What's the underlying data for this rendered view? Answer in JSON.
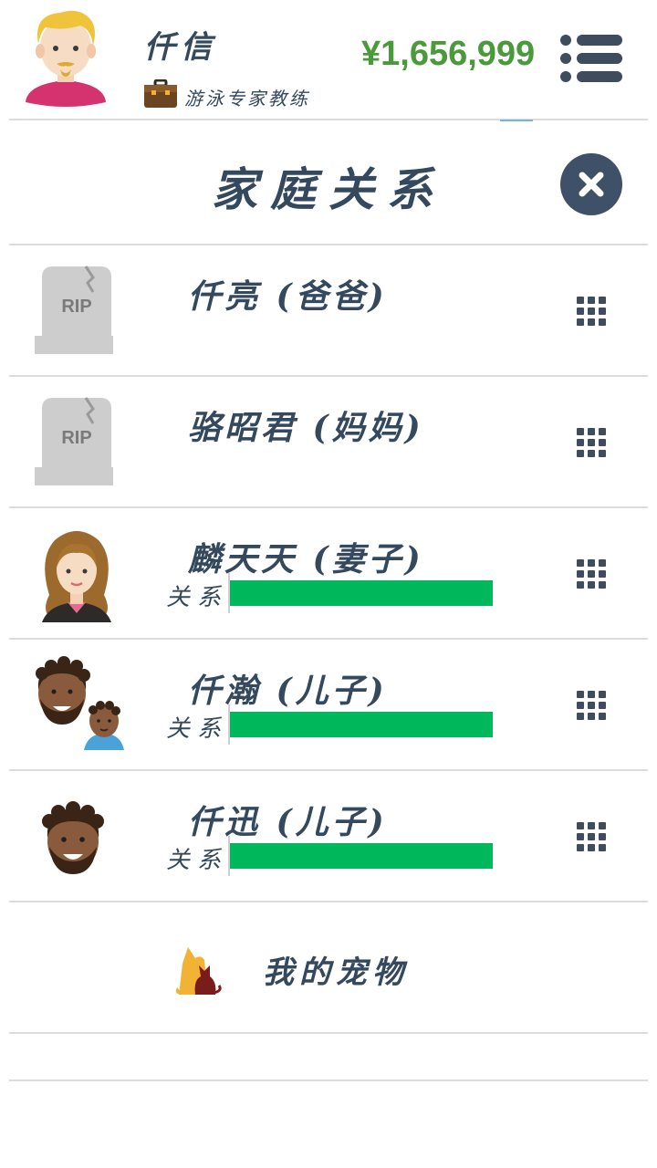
{
  "header": {
    "player_name": "仟信",
    "job_title": "游泳专家教练",
    "money": "¥1,656,999"
  },
  "title": "家庭关系",
  "relationship_label": "关系",
  "family": [
    {
      "name": "仟亮 (爸爸)",
      "status": "deceased",
      "avatar": "rip-tombstone-icon",
      "relationship": null
    },
    {
      "name": "骆昭君 (妈妈)",
      "status": "deceased",
      "avatar": "rip-tombstone-icon",
      "relationship": null
    },
    {
      "name": "麟天天 (妻子)",
      "status": "alive",
      "avatar": "wife-avatar-icon",
      "relationship": 1.0
    },
    {
      "name": "仟瀚 (儿子)",
      "status": "alive",
      "avatar": "son-with-child-avatar-icon",
      "relationship": 1.0
    },
    {
      "name": "仟迅 (儿子)",
      "status": "alive",
      "avatar": "son-avatar-icon",
      "relationship": 1.0
    }
  ],
  "pets_label": "我的宠物",
  "colors": {
    "text": "#34495e",
    "money": "#4a9a3c",
    "relationship_bar": "#00b85c",
    "close_button": "#3e5168",
    "divider": "#dcdcdc"
  },
  "icons": {
    "menu": "list-menu-icon",
    "close": "close-icon",
    "row_action": "grid-dots-icon",
    "job": "briefcase-icon",
    "pets": "dog-cat-icon"
  }
}
